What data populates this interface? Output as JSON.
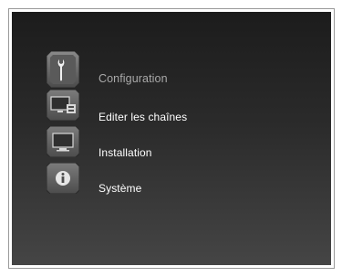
{
  "menu": {
    "header": {
      "label": "Configuration",
      "icon": "wrench-icon"
    },
    "items": [
      {
        "label": "Editer les chaînes",
        "icon": "tv-edit-icon"
      },
      {
        "label": "Installation",
        "icon": "tv-icon"
      },
      {
        "label": "Système",
        "icon": "info-icon"
      }
    ]
  },
  "colors": {
    "background_top": "#1c1c1c",
    "background_bottom": "#454545",
    "text": "#ffffff",
    "text_dim": "#a9a9a9",
    "icon_face": "#6a6a6a"
  }
}
